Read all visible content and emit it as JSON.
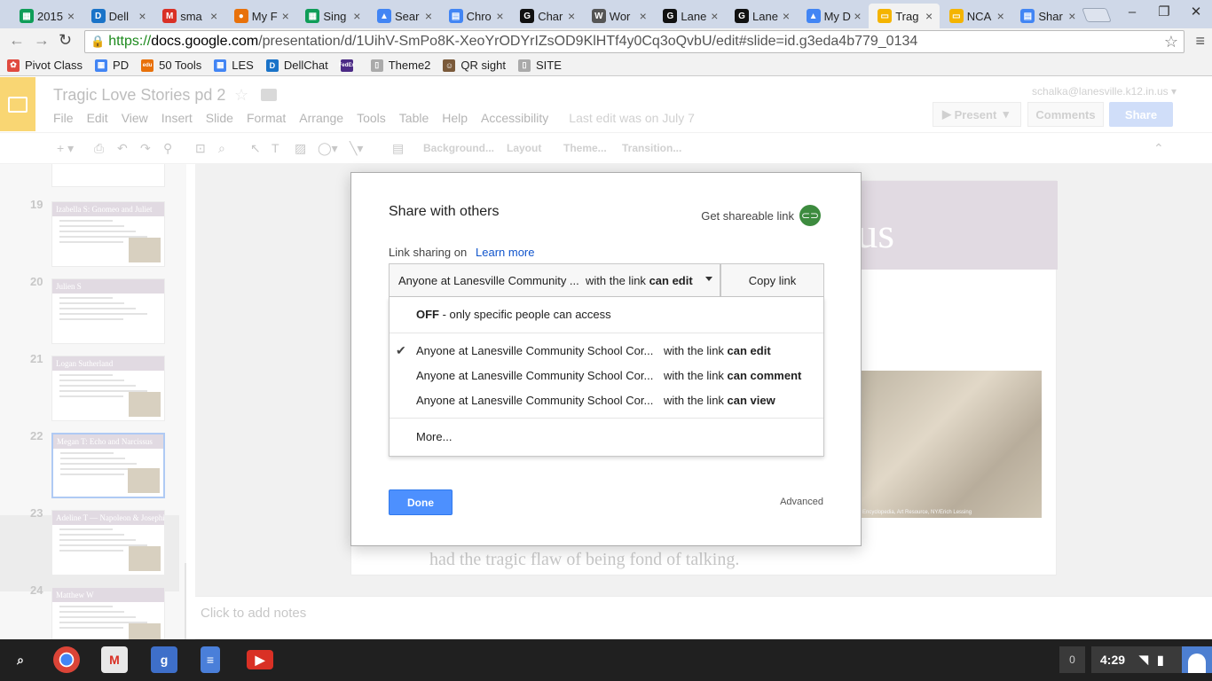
{
  "browser": {
    "tabs": [
      {
        "label": "2015",
        "color": "#0f9d58",
        "glyph": "▦"
      },
      {
        "label": "Dell",
        "color": "#1a73c8",
        "glyph": "D"
      },
      {
        "label": "sma",
        "color": "#d93025",
        "glyph": "M"
      },
      {
        "label": "My F",
        "color": "#e8710a",
        "glyph": "●"
      },
      {
        "label": "Sing",
        "color": "#0f9d58",
        "glyph": "▦"
      },
      {
        "label": "Sear",
        "color": "#4285f4",
        "glyph": "▲"
      },
      {
        "label": "Chro",
        "color": "#4285f4",
        "glyph": "▤"
      },
      {
        "label": "Char",
        "color": "#111111",
        "glyph": "G"
      },
      {
        "label": "Wor",
        "color": "#555555",
        "glyph": "W"
      },
      {
        "label": "Lane",
        "color": "#111111",
        "glyph": "G"
      },
      {
        "label": "Lane",
        "color": "#111111",
        "glyph": "G"
      },
      {
        "label": "My D",
        "color": "#4285f4",
        "glyph": "▲"
      },
      {
        "label": "Trag",
        "color": "#f4b400",
        "glyph": "▭",
        "active": true
      },
      {
        "label": "NCA",
        "color": "#f4b400",
        "glyph": "▭"
      },
      {
        "label": "Shar",
        "color": "#4285f4",
        "glyph": "▤"
      }
    ],
    "url_scheme": "https://",
    "url_host": "docs.google.com",
    "url_path": "/presentation/d/1UihV-SmPo8K-XeoYrODYrIZsOD9KlHTf4y0Cq3oQvbU/edit#slide=id.g3eda4b779_0134",
    "bookmarks": [
      {
        "label": "Pivot Class",
        "color": "#e04a3f",
        "glyph": "✿"
      },
      {
        "label": "PD",
        "color": "#4285f4",
        "glyph": "▦"
      },
      {
        "label": "50 Tools",
        "color": "#e8710a",
        "glyph": "edu"
      },
      {
        "label": "LES",
        "color": "#4285f4",
        "glyph": "▦"
      },
      {
        "label": "DellChat",
        "color": "#1a73c8",
        "glyph": "D"
      },
      {
        "label": "",
        "color": "#4b2a85",
        "glyph": "FedEx"
      },
      {
        "label": "Theme2",
        "color": "#aaaaaa",
        "glyph": "▯"
      },
      {
        "label": "QR sight",
        "color": "#7a5a3a",
        "glyph": "☺"
      },
      {
        "label": "SITE",
        "color": "#aaaaaa",
        "glyph": "▯"
      }
    ]
  },
  "app": {
    "doc_title": "Tragic Love Stories pd 2",
    "user_email": "schalka@lanesville.k12.in.us",
    "menus": [
      "File",
      "Edit",
      "View",
      "Insert",
      "Slide",
      "Format",
      "Arrange",
      "Tools",
      "Table",
      "Help",
      "Accessibility"
    ],
    "last_edit": "Last edit was on July 7",
    "present_label": "Present",
    "comments_label": "Comments",
    "share_label": "Share",
    "toolbar_text": [
      "Background...",
      "Layout",
      "Theme...",
      "Transition..."
    ]
  },
  "filmstrip": [
    {
      "num": "19",
      "title": "Izabella S: Gnomeo and Juliet",
      "has_image": true
    },
    {
      "num": "20",
      "title": "Julien S",
      "has_image": false
    },
    {
      "num": "21",
      "title": "Logan Sutherland",
      "has_image": true
    },
    {
      "num": "22",
      "title": "Megan T: Echo and Narcissus",
      "has_image": true,
      "selected": true
    },
    {
      "num": "23",
      "title": "Adeline T — Napoleon & Josephine",
      "has_image": true
    },
    {
      "num": "24",
      "title": "Matthew W",
      "has_image": true
    }
  ],
  "slide": {
    "title_fragment": "rcissus",
    "body_fragment": "had the tragic flaw of being fond of talking.",
    "credit": "Encyclopedia, Art Resource, NY/Erich Lessing",
    "notes_placeholder": "Click to add notes"
  },
  "dialog": {
    "title": "Share with others",
    "get_link": "Get shareable link",
    "link_status": "Link sharing on",
    "learn_more": "Learn more",
    "selected_who": "Anyone at Lanesville Community ...",
    "selected_suffix": "with the link",
    "selected_perm": "can edit",
    "copy_link": "Copy link",
    "off_bold": "OFF",
    "off_rest": " - only specific people can access",
    "options": [
      {
        "who": "Anyone at Lanesville Community School Cor...",
        "suffix": "with the link ",
        "perm": "can edit",
        "checked": true
      },
      {
        "who": "Anyone at Lanesville Community School Cor...",
        "suffix": "with the link ",
        "perm": "can comment",
        "checked": false
      },
      {
        "who": "Anyone at Lanesville Community School Cor...",
        "suffix": "with the link ",
        "perm": "can view",
        "checked": false
      }
    ],
    "more": "More...",
    "done": "Done",
    "advanced": "Advanced"
  },
  "shelf": {
    "notifications": "0",
    "time": "4:29"
  }
}
